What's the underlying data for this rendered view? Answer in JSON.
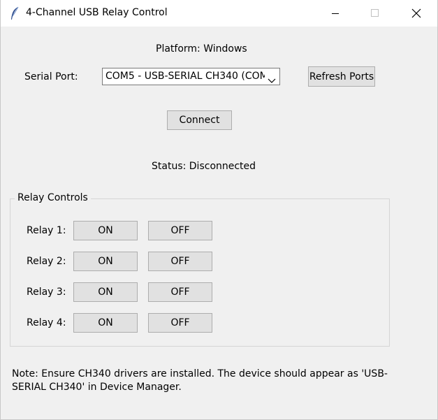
{
  "window": {
    "title": "4-Channel USB Relay Control"
  },
  "platform_text": "Platform: Windows",
  "serial_port": {
    "label": "Serial Port:",
    "selected": "COM5 - USB-SERIAL CH340 (COM",
    "refresh_label": "Refresh Ports"
  },
  "connect_label": "Connect",
  "status_text": "Status: Disconnected",
  "relay_group": {
    "title": "Relay Controls",
    "relays": [
      {
        "label": "Relay 1:",
        "on": "ON",
        "off": "OFF"
      },
      {
        "label": "Relay 2:",
        "on": "ON",
        "off": "OFF"
      },
      {
        "label": "Relay 3:",
        "on": "ON",
        "off": "OFF"
      },
      {
        "label": "Relay 4:",
        "on": "ON",
        "off": "OFF"
      }
    ]
  },
  "note": "Note: Ensure CH340 drivers are installed. The device should appear as 'USB-SERIAL CH340' in Device Manager."
}
